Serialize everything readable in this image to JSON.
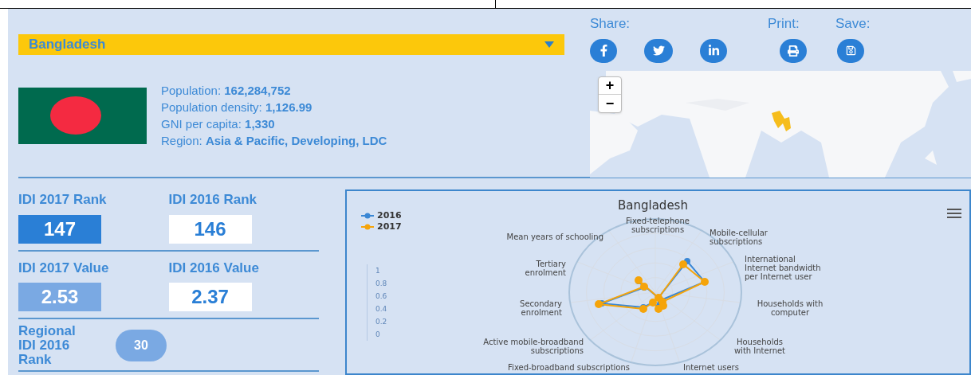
{
  "country_select": {
    "value": "Bangladesh"
  },
  "share": {
    "label": "Share:"
  },
  "print": {
    "label": "Print:"
  },
  "save": {
    "label": "Save:"
  },
  "map": {
    "kind": "picture",
    "zoom_in": "+",
    "zoom_out": "−"
  },
  "stats": [
    {
      "label": "Population:",
      "value": "162,284,752"
    },
    {
      "label": "Population density:",
      "value": "1,126.99"
    },
    {
      "label": "GNI per capita:",
      "value": "1,330"
    },
    {
      "label": "Region:",
      "value": "Asia & Pacific, Developing, LDC"
    }
  ],
  "idi": [
    {
      "label": "IDI 2017 Rank",
      "value": "147",
      "kind": "dark"
    },
    {
      "label": "IDI 2016 Rank",
      "value": "146",
      "kind": "white"
    },
    {
      "label": "IDI 2017 Value",
      "value": "2.53",
      "kind": "light"
    },
    {
      "label": "IDI 2016 Value",
      "value": "2.37",
      "kind": "white"
    }
  ],
  "regional": {
    "label": "Regional IDI 2016 Rank",
    "value": "30"
  },
  "chart": {
    "title": "Bangladesh",
    "legend": [
      {
        "name": "2016",
        "color": "#3a87d4"
      },
      {
        "name": "2017",
        "color": "#f5a40a"
      }
    ],
    "scale": [
      "1",
      "0.8",
      "0.6",
      "0.4",
      "0.2",
      "0"
    ],
    "axes": [
      "Fixed-telephone subscriptions",
      "Mean years of schooling",
      "Mobile-cellular subscriptions",
      "Tertiary enrolment",
      "International Internet bandwidth per Internet user",
      "Secondary enrolment",
      "Households with computer",
      "Active mobile-broadband subscriptions",
      "Households with Internet",
      "Fixed-broadband subscriptions",
      "Internet users"
    ]
  }
}
